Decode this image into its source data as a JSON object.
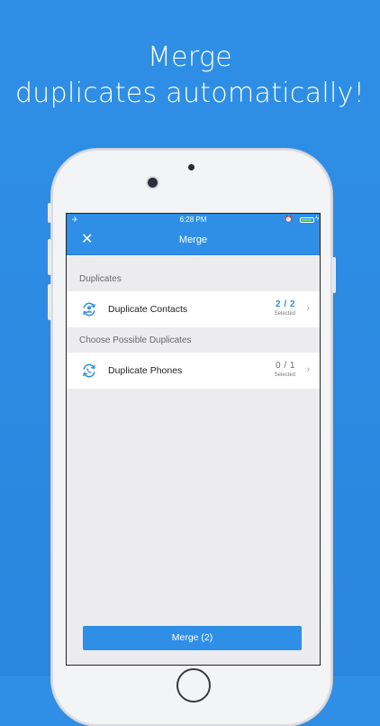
{
  "headline": {
    "line1": "Merge",
    "line2": "duplicates automatically!"
  },
  "statusbar": {
    "time": "6:28 PM"
  },
  "navbar": {
    "title": "Merge",
    "close_icon": "close-icon"
  },
  "sections": [
    {
      "header": "Duplicates",
      "row": {
        "label": "Duplicate Contacts",
        "count": "2 / 2",
        "sub": "Selected",
        "icon": "merge-contacts-icon"
      }
    },
    {
      "header": "Choose Possible Duplicates",
      "row": {
        "label": "Duplicate Phones",
        "count": "0 / 1",
        "sub": "Selected",
        "icon": "merge-phones-icon"
      }
    }
  ],
  "merge_button": {
    "label": "Merge (2)"
  },
  "colors": {
    "accent": "#2f8fe6",
    "background": "#2f8fe6"
  }
}
